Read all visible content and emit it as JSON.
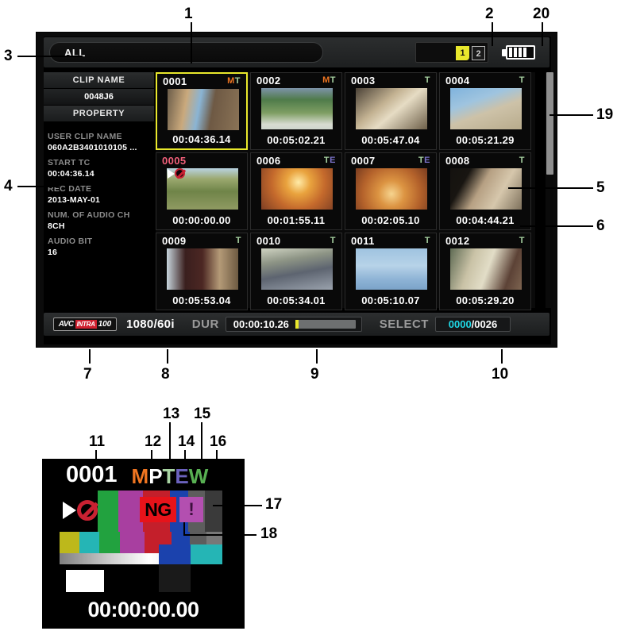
{
  "main_screen": {
    "filter": {
      "label": "ALL"
    },
    "slots": {
      "active": "1",
      "idle": "2"
    },
    "battery": {
      "bars": 4
    },
    "sidebar": {
      "clip_name_header": "CLIP NAME",
      "clip_name_value": "0048J6",
      "property_header": "PROPERTY",
      "properties": [
        {
          "key": "USER CLIP NAME",
          "value": "060A2B3401010105 ..."
        },
        {
          "key": "START TC",
          "value": "00:04:36.14"
        },
        {
          "key": "REC DATE",
          "value": "2013-MAY-01"
        },
        {
          "key": "NUM. OF AUDIO CH",
          "value": "8CH"
        },
        {
          "key": "AUDIO BIT",
          "value": "16"
        }
      ]
    },
    "clips": [
      {
        "id": "0001",
        "flags": "MT",
        "timecode": "00:04:36.14",
        "selected": true,
        "id_color": "white"
      },
      {
        "id": "0002",
        "flags": "MT",
        "timecode": "00:05:02.21",
        "selected": false,
        "id_color": "white"
      },
      {
        "id": "0003",
        "flags": "T",
        "timecode": "00:05:47.04",
        "selected": false,
        "id_color": "white"
      },
      {
        "id": "0004",
        "flags": "T",
        "timecode": "00:05:21.29",
        "selected": false,
        "id_color": "white"
      },
      {
        "id": "0005",
        "flags": "",
        "timecode": "00:00:00.00",
        "selected": false,
        "id_color": "pink"
      },
      {
        "id": "0006",
        "flags": "TE",
        "timecode": "00:01:55.11",
        "selected": false,
        "id_color": "white"
      },
      {
        "id": "0007",
        "flags": "TE",
        "timecode": "00:02:05.10",
        "selected": false,
        "id_color": "white"
      },
      {
        "id": "0008",
        "flags": "T",
        "timecode": "00:04:44.21",
        "selected": false,
        "id_color": "white"
      },
      {
        "id": "0009",
        "flags": "T",
        "timecode": "00:05:53.04",
        "selected": false,
        "id_color": "white"
      },
      {
        "id": "0010",
        "flags": "T",
        "timecode": "00:05:34.01",
        "selected": false,
        "id_color": "white"
      },
      {
        "id": "0011",
        "flags": "T",
        "timecode": "00:05:10.07",
        "selected": false,
        "id_color": "white"
      },
      {
        "id": "0012",
        "flags": "T",
        "timecode": "00:05:29.20",
        "selected": false,
        "id_color": "white"
      }
    ],
    "status_bar": {
      "codec_a": "AVC",
      "codec_i": "INTRA",
      "codec_n": "100",
      "format": "1080/60i",
      "dur_label": "DUR",
      "dur_value": "00:00:10.26",
      "select_label": "SELECT",
      "select_current": "0000",
      "select_separator": "/",
      "select_total": "0026"
    }
  },
  "detail_panel": {
    "clip_id": "0001",
    "flags": [
      "M",
      "P",
      "T",
      "E",
      "W"
    ],
    "badge_play": "play-icon",
    "badge_prohibited": "prohibited-icon",
    "ng_label": "NG",
    "exclamation_label": "!",
    "timecode": "00:00:00.00"
  },
  "callouts": [
    {
      "n": "1"
    },
    {
      "n": "2"
    },
    {
      "n": "3"
    },
    {
      "n": "4"
    },
    {
      "n": "5"
    },
    {
      "n": "6"
    },
    {
      "n": "7"
    },
    {
      "n": "8"
    },
    {
      "n": "9"
    },
    {
      "n": "10"
    },
    {
      "n": "11"
    },
    {
      "n": "12"
    },
    {
      "n": "13"
    },
    {
      "n": "14"
    },
    {
      "n": "15"
    },
    {
      "n": "16"
    },
    {
      "n": "17"
    },
    {
      "n": "18"
    },
    {
      "n": "19"
    },
    {
      "n": "20"
    }
  ],
  "colors": {
    "accent_yellow": "#e9e82c",
    "flag_M": "#ef7521",
    "flag_T": "#a8d3a2",
    "flag_E": "#6b62bd",
    "flag_W": "#58b052",
    "pink_id": "#f2607a",
    "cyan_select": "#1fd9e6",
    "ng_red": "#e7131a",
    "excl_magenta": "#b34fb0"
  }
}
